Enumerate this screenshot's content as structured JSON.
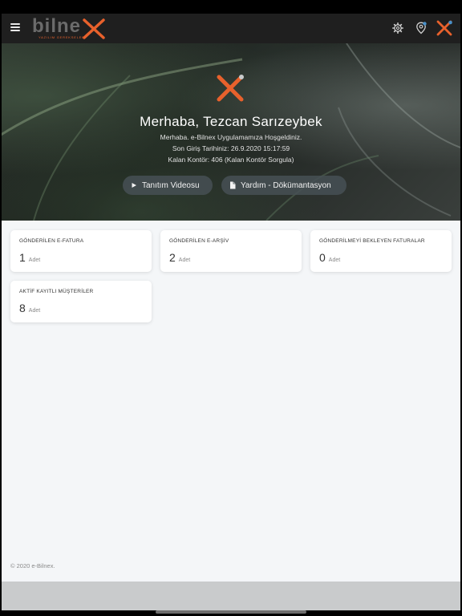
{
  "header": {
    "brand": "bilne",
    "tagline": "YAZILIM GEREKSELERİ",
    "icons": [
      "menu-icon",
      "gear-icon",
      "location-icon",
      "bilnex-x-icon"
    ]
  },
  "hero": {
    "greeting": "Merhaba, Tezcan Sarızeybek",
    "welcome": "Merhaba. e-Bilnex Uygulamamıza Hoşgeldiniz.",
    "last_login": "Son Giriş Tarihiniz: 26.9.2020 15:17:59",
    "credit": "Kalan Kontör: 406 (Kalan Kontör Sorgula)",
    "btn_video": "Tanıtım Videosu",
    "btn_help": "Yardım - Dökümantasyon"
  },
  "cards": [
    {
      "label": "GÖNDERİLEN E-FATURA",
      "value": "1",
      "unit": "Adet"
    },
    {
      "label": "GÖNDERİLEN E-ARŞİV",
      "value": "2",
      "unit": "Adet"
    },
    {
      "label": "GÖNDERİLMEYİ BEKLEYEN FATURALAR",
      "value": "0",
      "unit": "Adet"
    },
    {
      "label": "AKTİF KAYITLI MÜŞTERİLER",
      "value": "8",
      "unit": "Adet"
    }
  ],
  "footer": {
    "copyright": "© 2020 e-Bilnex."
  },
  "colors": {
    "accent": "#e8612c",
    "topbar": "#1f1f1f",
    "background": "#f4f6f8"
  }
}
